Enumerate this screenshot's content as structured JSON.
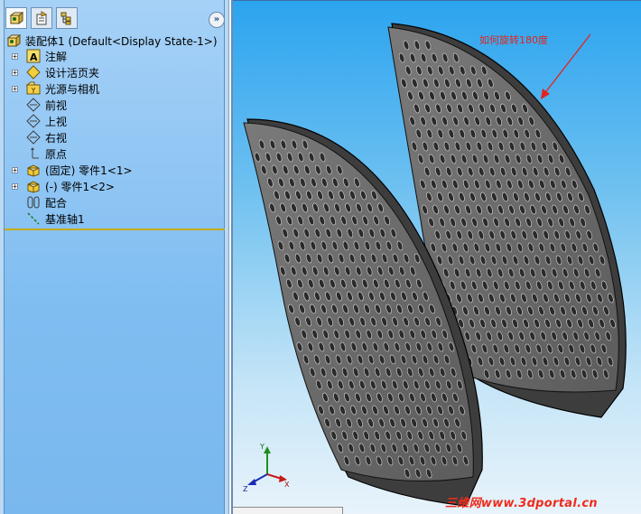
{
  "tree": {
    "root_label": "装配体1  (Default<Display State-1>)",
    "items": [
      {
        "label": "注解",
        "icon": "annotation-icon",
        "expandable": true
      },
      {
        "label": "设计活页夹",
        "icon": "design-binder-icon",
        "expandable": true
      },
      {
        "label": "光源与相机",
        "icon": "lights-cameras-icon",
        "expandable": true
      },
      {
        "label": "前视",
        "icon": "plane-icon",
        "expandable": false
      },
      {
        "label": "上视",
        "icon": "plane-icon",
        "expandable": false
      },
      {
        "label": "右视",
        "icon": "plane-icon",
        "expandable": false
      },
      {
        "label": "原点",
        "icon": "origin-icon",
        "expandable": false
      },
      {
        "label": "(固定) 零件1<1>",
        "icon": "part-icon",
        "expandable": true
      },
      {
        "label": "(-) 零件1<2>",
        "icon": "part-icon",
        "expandable": true
      },
      {
        "label": "配合",
        "icon": "mates-icon",
        "expandable": false
      },
      {
        "label": "基准轴1",
        "icon": "axis-icon",
        "expandable": false
      }
    ]
  },
  "tabs": [
    {
      "name": "feature-manager",
      "icon": "assembly-tree-icon"
    },
    {
      "name": "property-manager",
      "icon": "property-manager-icon"
    },
    {
      "name": "configuration-manager",
      "icon": "configuration-manager-icon"
    }
  ],
  "collapse_label": "»",
  "viewport": {
    "annotation": "如何旋转180度",
    "watermark": "三维网www.3dportal.cn",
    "triad": {
      "x": "X",
      "y": "Y",
      "z": "Z"
    }
  },
  "colors": {
    "accent_red": "#e3231c",
    "part_fill": "#6e6e6e",
    "tree_rule": "#c8a900"
  }
}
